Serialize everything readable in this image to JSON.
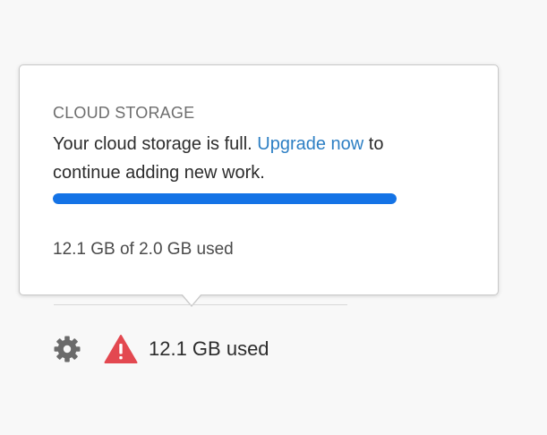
{
  "storage_popover": {
    "heading": "CLOUD STORAGE",
    "message_prefix": "Your cloud storage is full. ",
    "upgrade_link_label": "Upgrade now",
    "message_suffix": " to continue adding new work.",
    "usage_detail": "12.1 GB of 2.0 GB used",
    "progress_percent": 100
  },
  "footer": {
    "settings_icon": "gear-icon",
    "warning_icon": "warning-icon",
    "usage_label": "12.1 GB used"
  },
  "colors": {
    "link": "#2d7fc4",
    "progress": "#1473e6",
    "warning": "#e34850"
  }
}
